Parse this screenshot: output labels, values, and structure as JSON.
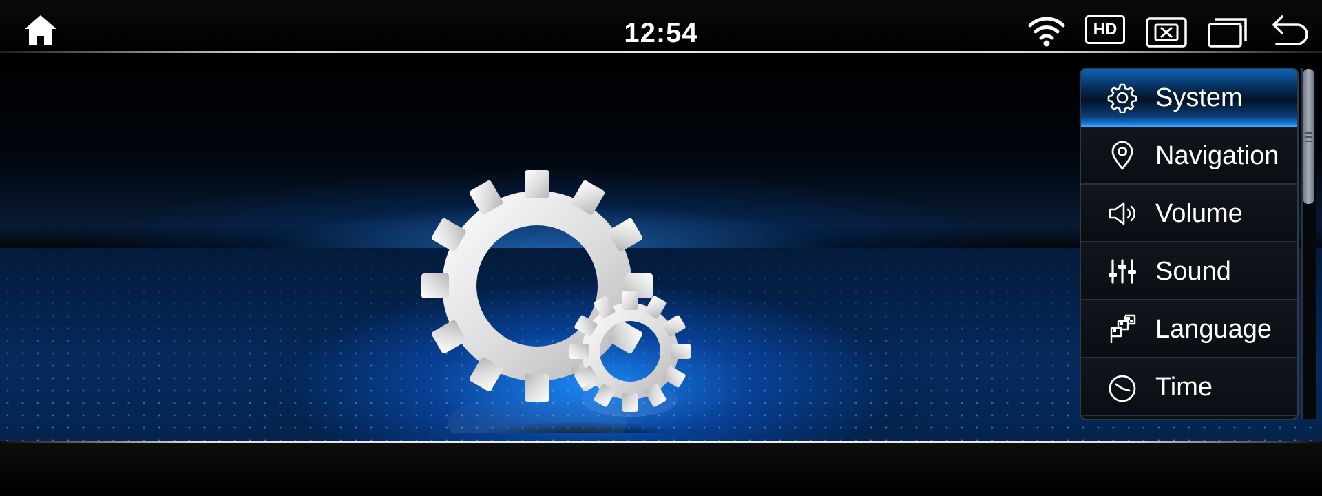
{
  "status_bar": {
    "time": "12:54",
    "home_icon": "home-icon",
    "wifi_icon": "wifi-icon",
    "hd_label": "HD",
    "close_window_icon": "close-window-icon",
    "multi_window_icon": "multi-window-icon",
    "back_icon": "back-arrow-icon"
  },
  "hero": {
    "icon": "settings-gears-icon",
    "accent_color": "#1a8df0"
  },
  "menu": {
    "items": [
      {
        "label": "System",
        "icon": "gear-icon",
        "selected": true
      },
      {
        "label": "Navigation",
        "icon": "location-pin-icon",
        "selected": false
      },
      {
        "label": "Volume",
        "icon": "speaker-icon",
        "selected": false
      },
      {
        "label": "Sound",
        "icon": "equalizer-icon",
        "selected": false
      },
      {
        "label": "Language",
        "icon": "language-flags-icon",
        "selected": false
      },
      {
        "label": "Time",
        "icon": "clock-icon",
        "selected": false
      }
    ],
    "selected_color": "#0e64b8"
  }
}
